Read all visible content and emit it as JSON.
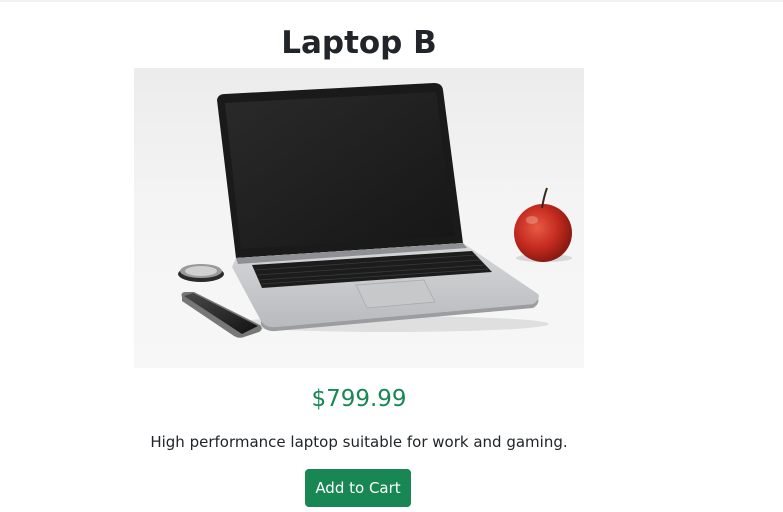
{
  "product": {
    "title": "Laptop B",
    "price": "$799.99",
    "description": "High performance laptop suitable for work and gaming.",
    "image_alt": "Laptop on a white desk with a phone and an apple"
  },
  "actions": {
    "add_to_cart_label": "Add to Cart"
  },
  "colors": {
    "price": "#198754",
    "button_bg": "#198754",
    "button_text": "#ffffff"
  }
}
